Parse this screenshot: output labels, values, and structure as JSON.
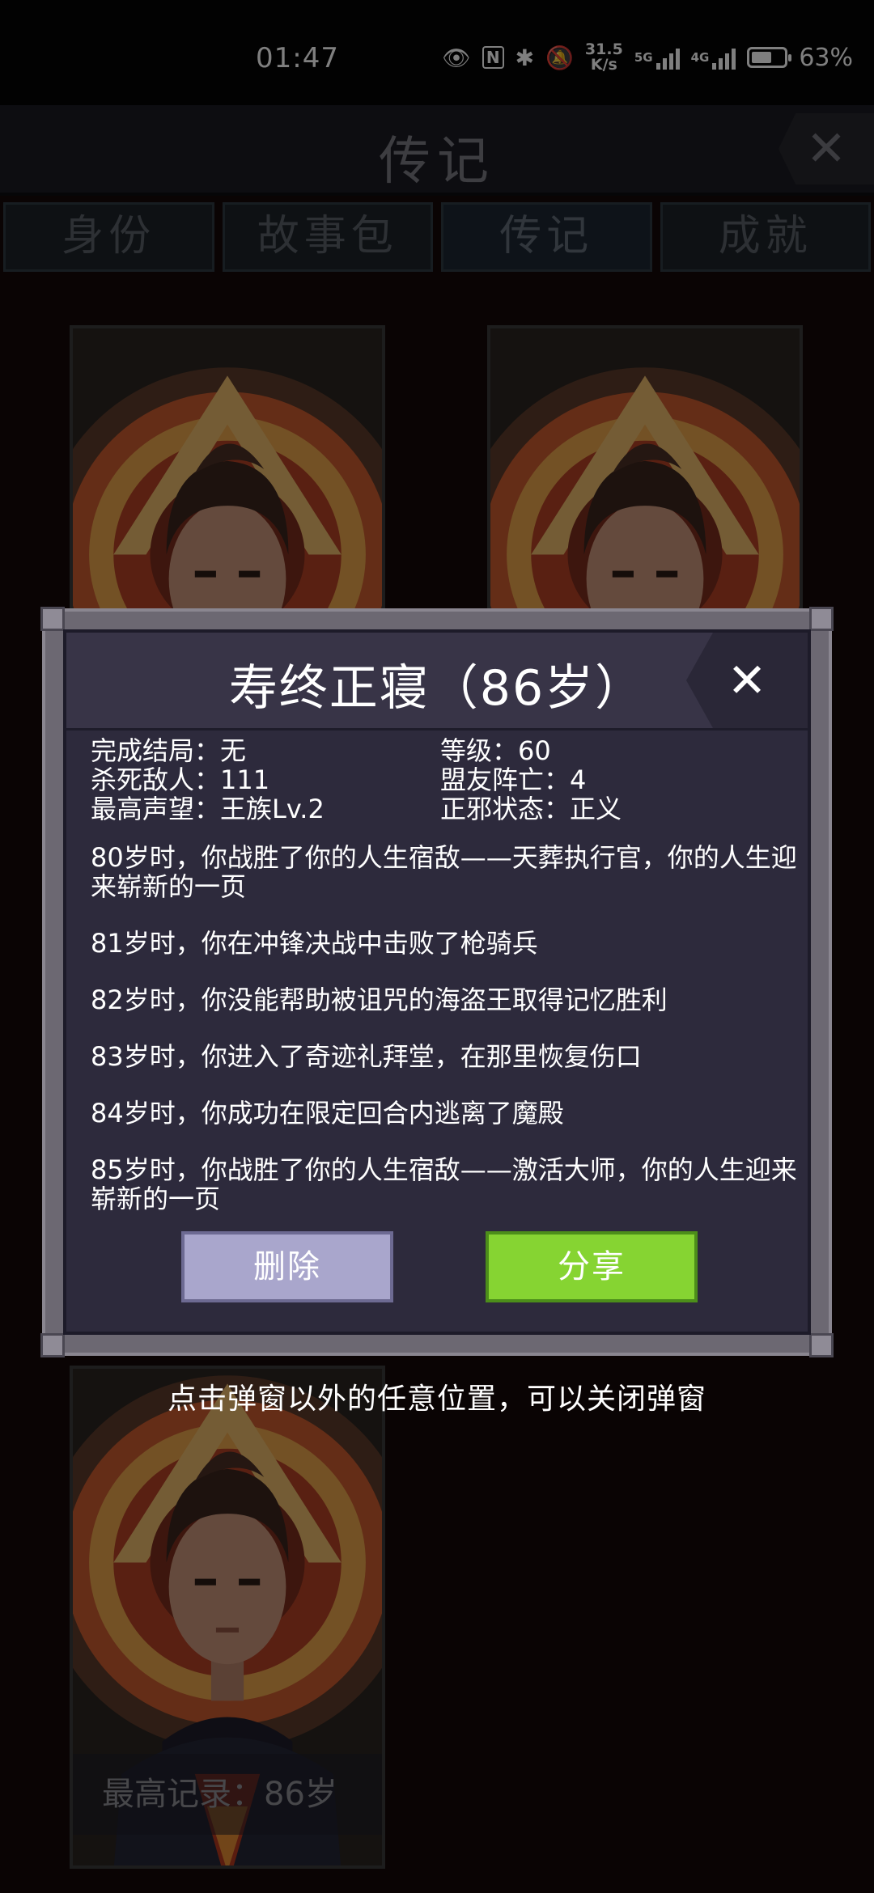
{
  "status_bar": {
    "time": "01:47",
    "net_speed": "31.5",
    "net_unit": "K/s",
    "sig1": "5G",
    "sig2": "4G",
    "battery": "63%",
    "battery_level": 0.63
  },
  "header": {
    "title": "传记",
    "close": "✕"
  },
  "tabs": [
    {
      "label": "身份"
    },
    {
      "label": "故事包"
    },
    {
      "label": "传记",
      "active": true
    },
    {
      "label": "成就"
    }
  ],
  "cards": [
    {
      "caption": ""
    },
    {
      "caption": ""
    },
    {
      "caption": "最高记录：86岁"
    }
  ],
  "dialog": {
    "title": "寿终正寝（86岁）",
    "close": "✕",
    "stats": [
      "完成结局：无",
      "等级：60",
      "杀死敌人：111",
      "盟友阵亡：4",
      "最高声望：王族Lv.2",
      "正邪状态：正义"
    ],
    "events": [
      "80岁时，你战胜了你的人生宿敌——天葬执行官，你的人生迎来崭新的一页",
      "81岁时，你在冲锋决战中击败了枪骑兵",
      "82岁时，你没能帮助被诅咒的海盗王取得记忆胜利",
      "83岁时，你进入了奇迹礼拜堂，在那里恢复伤口",
      "84岁时，你成功在限定回合内逃离了魔殿",
      "85岁时，你战胜了你的人生宿敌——激活大师，你的人生迎来崭新的一页"
    ],
    "delete_label": "删除",
    "share_label": "分享"
  },
  "hint": "点击弹窗以外的任意位置，可以关闭弹窗",
  "colors": {
    "share": "#86d432",
    "delete": "#a9a6cc",
    "dialog_bg": "#2d2a3c"
  }
}
